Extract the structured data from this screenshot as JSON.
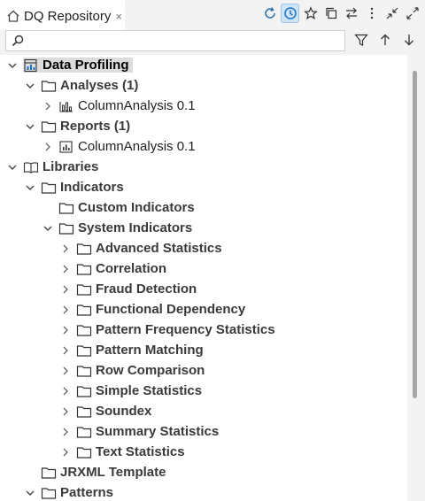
{
  "view": {
    "title": "DQ Repository",
    "close_glyph": "×"
  },
  "toolbar": {
    "items": [
      "refresh-icon",
      "history-icon",
      "star-icon",
      "copy-icon",
      "link-icon",
      "menu-icon",
      "minimize-icon",
      "maximize-icon"
    ]
  },
  "search": {
    "value": "",
    "placeholder": ""
  },
  "filter_tools": [
    "filter-icon",
    "arrow-up-icon",
    "arrow-down-icon"
  ],
  "tree": {
    "items": [
      {
        "label": "Data Profiling",
        "level": 0,
        "twisty": "expanded",
        "icon": "data-profiling-icon",
        "bold": true,
        "selected": true
      },
      {
        "label": "Analyses (1)",
        "level": 1,
        "twisty": "expanded",
        "icon": "folder-icon",
        "bold": true
      },
      {
        "label": "ColumnAnalysis 0.1",
        "level": 2,
        "twisty": "collapsed",
        "icon": "analysis-icon",
        "bold": false
      },
      {
        "label": "Reports (1)",
        "level": 1,
        "twisty": "expanded",
        "icon": "folder-icon",
        "bold": true
      },
      {
        "label": "ColumnAnalysis 0.1",
        "level": 2,
        "twisty": "collapsed",
        "icon": "report-icon",
        "bold": false
      },
      {
        "label": "Libraries",
        "level": 0,
        "twisty": "expanded",
        "icon": "book-icon",
        "bold": true
      },
      {
        "label": "Indicators",
        "level": 1,
        "twisty": "expanded",
        "icon": "folder-icon",
        "bold": true
      },
      {
        "label": "Custom Indicators",
        "level": 2,
        "twisty": "none",
        "icon": "folder-icon",
        "bold": true
      },
      {
        "label": "System Indicators",
        "level": 2,
        "twisty": "expanded",
        "icon": "folder-icon",
        "bold": true
      },
      {
        "label": "Advanced Statistics",
        "level": 3,
        "twisty": "collapsed",
        "icon": "folder-icon",
        "bold": true
      },
      {
        "label": "Correlation",
        "level": 3,
        "twisty": "collapsed",
        "icon": "folder-icon",
        "bold": true
      },
      {
        "label": "Fraud Detection",
        "level": 3,
        "twisty": "collapsed",
        "icon": "folder-icon",
        "bold": true
      },
      {
        "label": "Functional Dependency",
        "level": 3,
        "twisty": "collapsed",
        "icon": "folder-icon",
        "bold": true
      },
      {
        "label": "Pattern Frequency Statistics",
        "level": 3,
        "twisty": "collapsed",
        "icon": "folder-icon",
        "bold": true
      },
      {
        "label": "Pattern Matching",
        "level": 3,
        "twisty": "collapsed",
        "icon": "folder-icon",
        "bold": true
      },
      {
        "label": "Row Comparison",
        "level": 3,
        "twisty": "collapsed",
        "icon": "folder-icon",
        "bold": true
      },
      {
        "label": "Simple Statistics",
        "level": 3,
        "twisty": "collapsed",
        "icon": "folder-icon",
        "bold": true
      },
      {
        "label": "Soundex",
        "level": 3,
        "twisty": "collapsed",
        "icon": "folder-icon",
        "bold": true
      },
      {
        "label": "Summary Statistics",
        "level": 3,
        "twisty": "collapsed",
        "icon": "folder-icon",
        "bold": true
      },
      {
        "label": "Text Statistics",
        "level": 3,
        "twisty": "collapsed",
        "icon": "folder-icon",
        "bold": true
      },
      {
        "label": "JRXML Template",
        "level": 1,
        "twisty": "none",
        "icon": "folder-icon",
        "bold": true
      },
      {
        "label": "Patterns",
        "level": 1,
        "twisty": "expanded",
        "icon": "folder-icon",
        "bold": true
      }
    ]
  },
  "colors": {
    "selection": "#dcdcdc",
    "active_tool": "#cfe3f7",
    "accent_icon": "#1a73c9",
    "text_bold": "#3a3a3a"
  }
}
